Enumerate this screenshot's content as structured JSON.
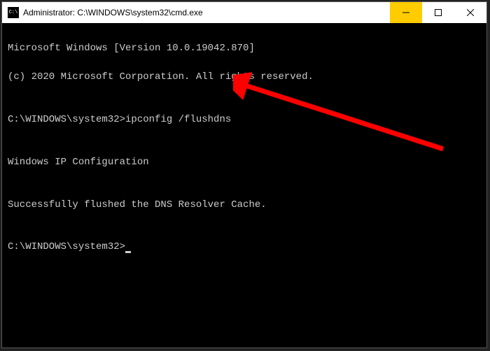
{
  "titlebar": {
    "icon_label": "C:\\",
    "title": "Administrator: C:\\WINDOWS\\system32\\cmd.exe"
  },
  "controls": {
    "minimize": "Minimize",
    "maximize": "Maximize",
    "close": "Close"
  },
  "terminal": {
    "line1": "Microsoft Windows [Version 10.0.19042.870]",
    "line2": "(c) 2020 Microsoft Corporation. All rights reserved.",
    "blank1": "",
    "prompt1_path": "C:\\WINDOWS\\system32>",
    "prompt1_cmd": "ipconfig /flushdns",
    "blank2": "",
    "result_header": "Windows IP Configuration",
    "blank3": "",
    "result_msg": "Successfully flushed the DNS Resolver Cache.",
    "blank4": "",
    "prompt2_path": "C:\\WINDOWS\\system32>"
  }
}
